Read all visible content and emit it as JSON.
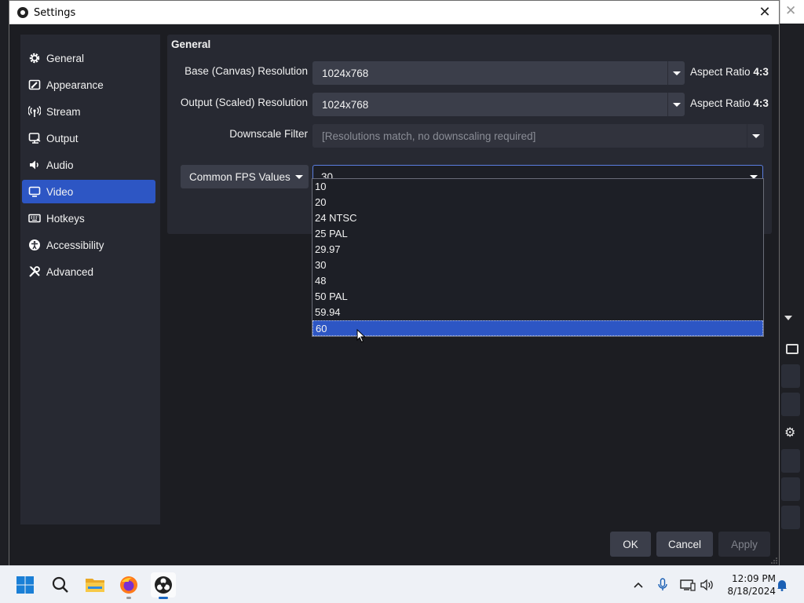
{
  "window": {
    "title": "Settings"
  },
  "sidebar": {
    "items": [
      {
        "label": "General",
        "icon": "gear-icon"
      },
      {
        "label": "Appearance",
        "icon": "appearance-icon"
      },
      {
        "label": "Stream",
        "icon": "broadcast-icon"
      },
      {
        "label": "Output",
        "icon": "output-icon"
      },
      {
        "label": "Audio",
        "icon": "speaker-icon"
      },
      {
        "label": "Video",
        "icon": "monitor-icon",
        "active": true
      },
      {
        "label": "Hotkeys",
        "icon": "keyboard-icon"
      },
      {
        "label": "Accessibility",
        "icon": "accessibility-icon"
      },
      {
        "label": "Advanced",
        "icon": "tools-icon"
      }
    ]
  },
  "panel": {
    "heading": "General",
    "base_label": "Base (Canvas) Resolution",
    "base_value": "1024x768",
    "base_aspect_prefix": "Aspect Ratio",
    "base_aspect_value": "4:3",
    "output_label": "Output (Scaled) Resolution",
    "output_value": "1024x768",
    "output_aspect_prefix": "Aspect Ratio",
    "output_aspect_value": "4:3",
    "downscale_label": "Downscale Filter",
    "downscale_value": "[Resolutions match, no downscaling required]",
    "fps_mode": "Common FPS Values",
    "fps_value": "30"
  },
  "fps_options": [
    "10",
    "20",
    "24 NTSC",
    "25 PAL",
    "29.97",
    "30",
    "48",
    "50 PAL",
    "59.94",
    "60"
  ],
  "fps_highlighted": "60",
  "buttons": {
    "ok": "OK",
    "cancel": "Cancel",
    "apply": "Apply"
  },
  "taskbar": {
    "time": "12:09 PM",
    "date": "8/18/2024"
  },
  "colors": {
    "accent": "#2d56c4",
    "background": "#1c1d22",
    "panel": "#272932"
  }
}
